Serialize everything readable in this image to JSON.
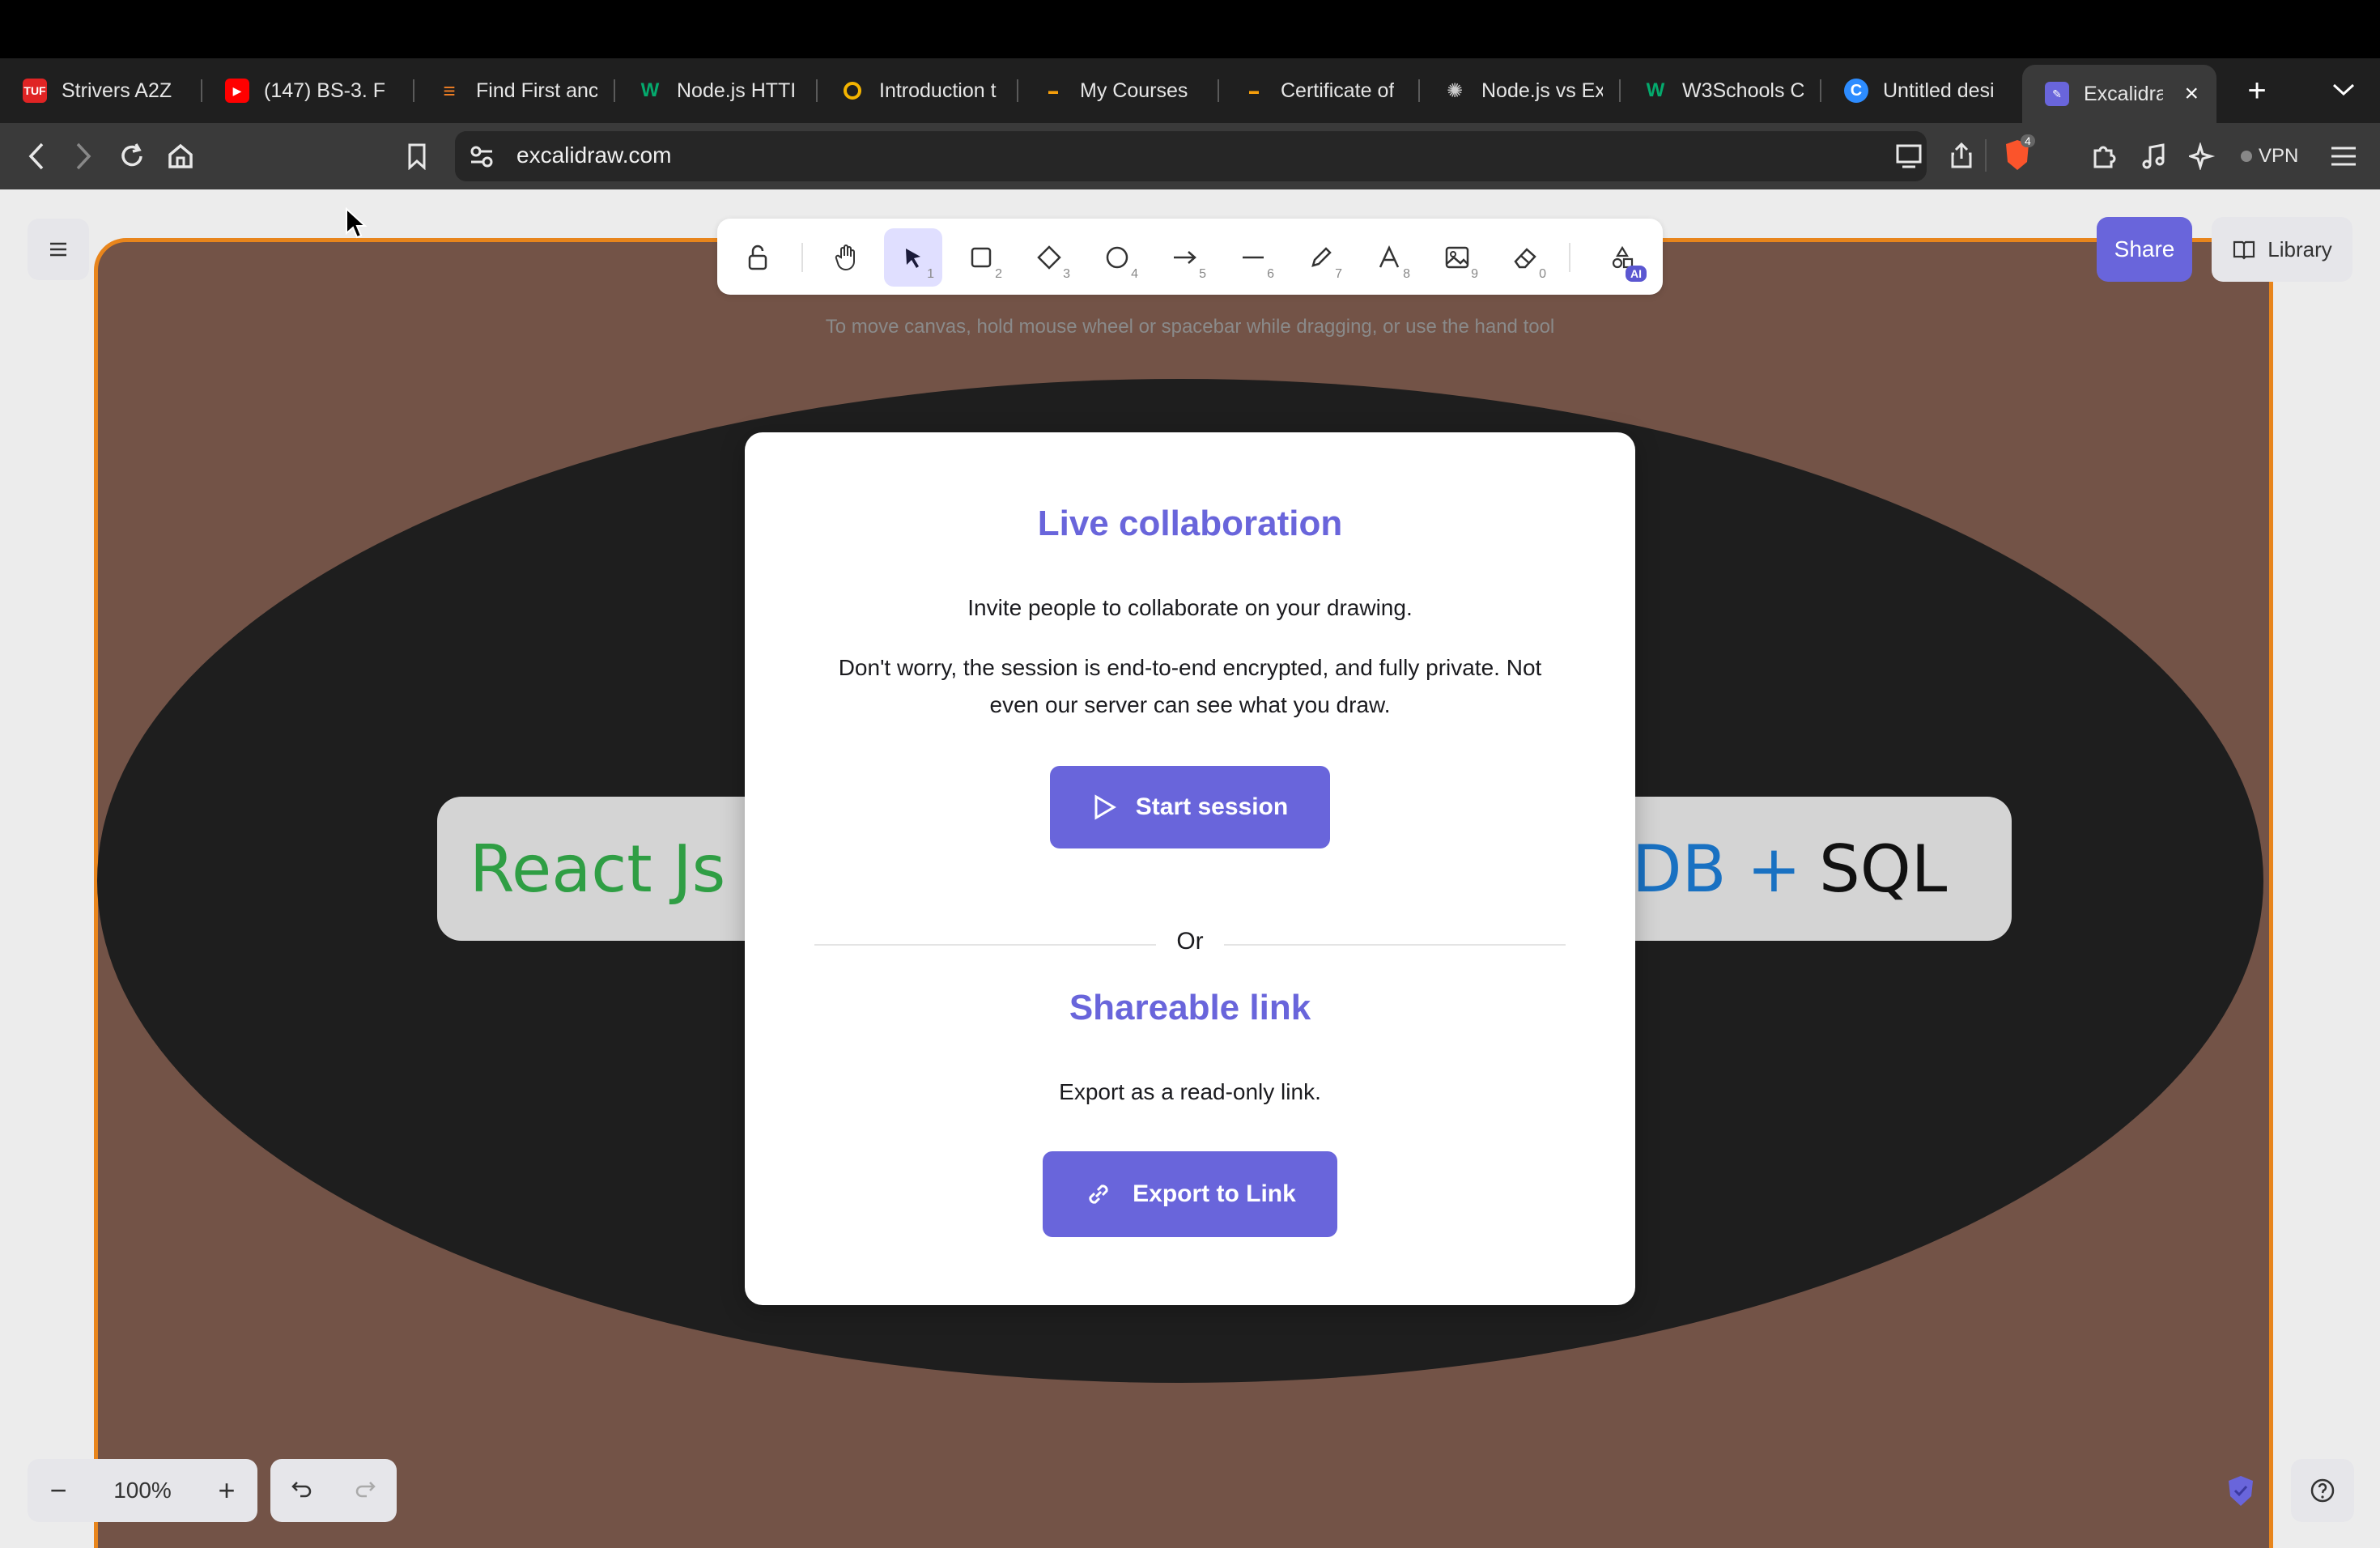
{
  "browser": {
    "tabs": [
      {
        "title": "Strivers A2Z",
        "favicon": "tuf-icon",
        "color": "#e02424"
      },
      {
        "title": "(147) BS-3. F",
        "favicon": "youtube-icon",
        "color": "#ff0000"
      },
      {
        "title": "Find First anc",
        "favicon": "stack-icon",
        "color": "#f48024"
      },
      {
        "title": "Node.js HTTI",
        "favicon": "w3-icon",
        "color": "#04aa6d"
      },
      {
        "title": "Introduction t",
        "favicon": "circle-icon",
        "color": "#f4b400"
      },
      {
        "title": "My Courses",
        "favicon": "coursera-icon",
        "color": "#f59e0b"
      },
      {
        "title": "Certificate of",
        "favicon": "coursera-icon",
        "color": "#f59e0b"
      },
      {
        "title": "Node.js vs Ex",
        "favicon": "openai-icon",
        "color": "#cccccc"
      },
      {
        "title": "W3Schools C",
        "favicon": "w3-icon",
        "color": "#04aa6d"
      },
      {
        "title": "Untitled desi",
        "favicon": "canva-icon",
        "color": "#2d8cff"
      },
      {
        "title": "Excalidra",
        "favicon": "excalidraw-icon",
        "color": "#6965db",
        "active": true
      }
    ],
    "url": "excalidraw.com",
    "shields_count": "4",
    "vpn_label": "VPN"
  },
  "app": {
    "hint": "To move canvas, hold mouse wheel or spacebar while dragging, or use the hand tool",
    "tool_keys": [
      "1",
      "2",
      "3",
      "4",
      "5",
      "6",
      "7",
      "8",
      "9",
      "0"
    ],
    "ai_badge": "AI",
    "share_label": "Share",
    "library_label": "Library",
    "zoom_level": "100%"
  },
  "canvas": {
    "left_pill_text": "React Js",
    "right_pill_db": "DB +",
    "right_pill_sql": "SQL"
  },
  "modal": {
    "title": "Live collaboration",
    "invite_text": "Invite people to collaborate on your drawing.",
    "privacy_text": "Don't worry, the session is end-to-end encrypted, and fully private. Not even our server can see what you draw.",
    "start_label": "Start session",
    "or_label": "Or",
    "link_title": "Shareable link",
    "link_text": "Export as a read-only link.",
    "export_label": "Export to Link"
  },
  "colors": {
    "accent": "#6965db",
    "frame_stroke": "#e8851c",
    "frame_fill": "#735347",
    "react_green": "#2f9e44",
    "db_blue": "#1971c2"
  }
}
